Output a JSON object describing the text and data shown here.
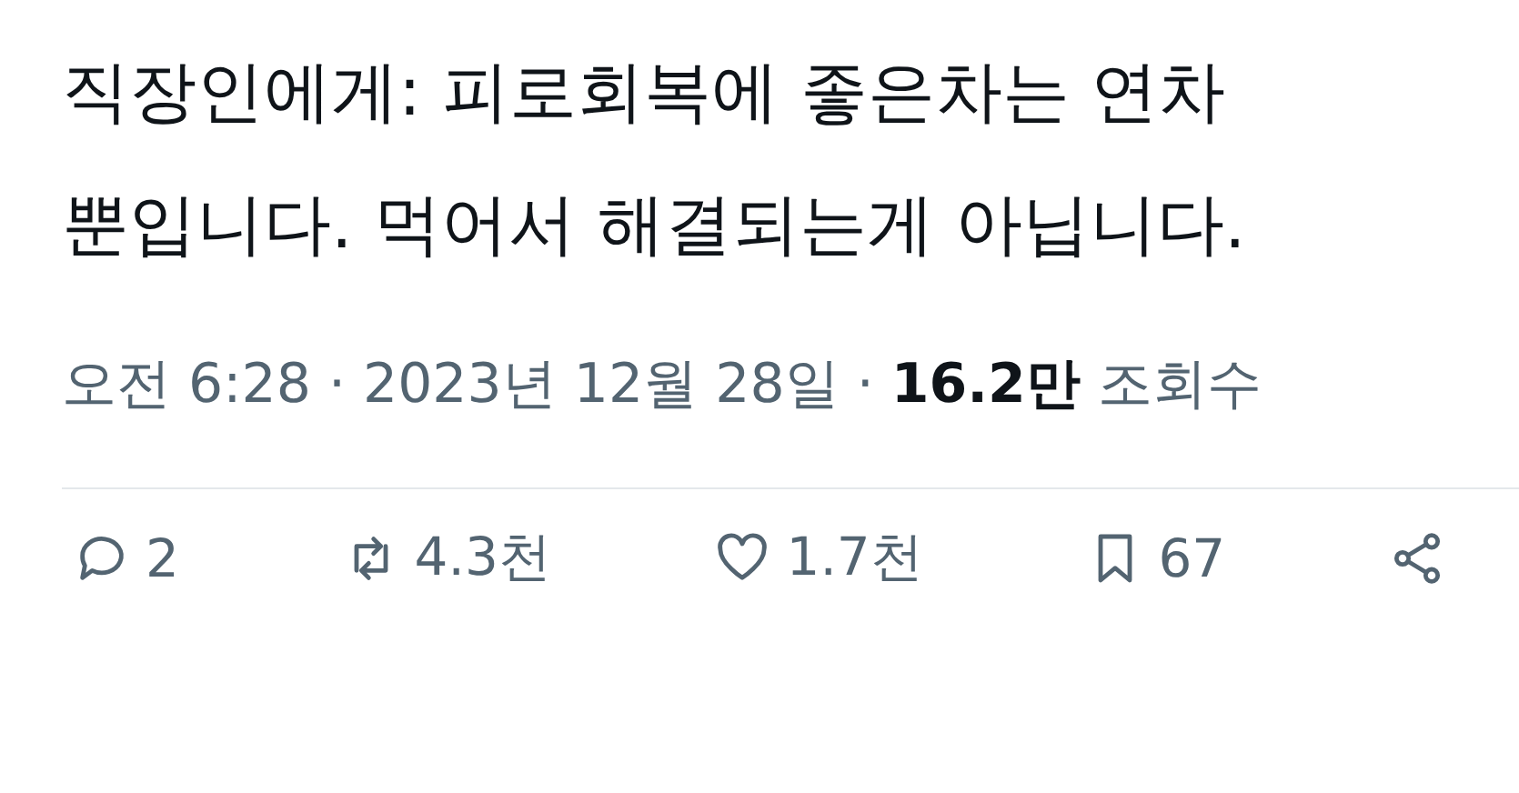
{
  "tweet": {
    "text": "직장인에게: 피로회복에 좋은차는 연차 뿐입니다. 먹어서 해결되는게 아닙니다.",
    "meta": "오전 6:28 · 2023년 12월 28일 · **16.2만** 조회수"
  },
  "actions": [
    {
      "kind": "reply",
      "count": "2"
    },
    {
      "kind": "repost",
      "count": "4.3천"
    },
    {
      "kind": "like",
      "count": "1.7천"
    },
    {
      "kind": "bookmark",
      "count": "67"
    },
    {
      "kind": "share"
    }
  ]
}
